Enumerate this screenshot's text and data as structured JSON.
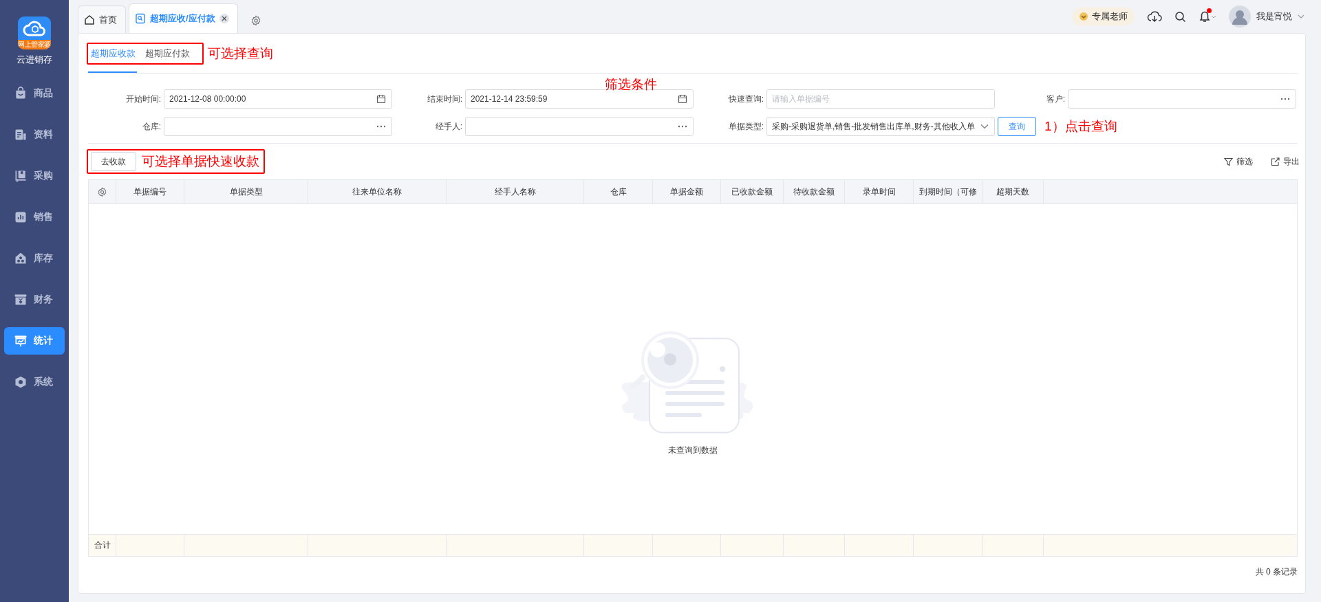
{
  "sidebar": {
    "logo_badge": "网上管家婆",
    "app_name": "云进销存",
    "items": [
      {
        "label": "商品",
        "kind": "goods",
        "selected": false
      },
      {
        "label": "资料",
        "kind": "records",
        "selected": false
      },
      {
        "label": "采购",
        "kind": "purchase",
        "selected": false
      },
      {
        "label": "销售",
        "kind": "sales",
        "selected": false
      },
      {
        "label": "库存",
        "kind": "stock",
        "selected": false
      },
      {
        "label": "财务",
        "kind": "finance",
        "selected": false
      },
      {
        "label": "统计",
        "kind": "stats",
        "selected": true
      },
      {
        "label": "系统",
        "kind": "system",
        "selected": false
      }
    ]
  },
  "top_tabs": [
    {
      "label": "首页",
      "kind": "home",
      "selected": false,
      "closable": false
    },
    {
      "label": "超期应收/应付款",
      "kind": "report",
      "selected": true,
      "closable": true
    }
  ],
  "header": {
    "teacher": "专属老师",
    "user_name": "我是宵悦",
    "has_notification": true
  },
  "subtabs": [
    {
      "label": "超期应收款",
      "selected": true
    },
    {
      "label": "超期应付款",
      "selected": false
    }
  ],
  "filters": [
    {
      "label": "开始时间:",
      "kind": "date",
      "value": "2021-12-08 00:00:00"
    },
    {
      "label": "结束时间:",
      "kind": "date",
      "value": "2021-12-14 23:59:59"
    },
    {
      "label": "快速查询:",
      "kind": "text",
      "placeholder": "请输入单据编号"
    },
    {
      "label": "客户:",
      "kind": "picker"
    },
    {
      "label": "仓库:",
      "kind": "picker"
    },
    {
      "label": "经手人:",
      "kind": "picker"
    },
    {
      "label": "单据类型:",
      "kind": "select",
      "value": "采购-采购退货单,销售-批发销售出库单,财务-其他收入单"
    }
  ],
  "query_button": "查询",
  "collect_button": "去收款",
  "toolbar": [
    {
      "label": "筛选",
      "kind": "filter"
    },
    {
      "label": "导出",
      "kind": "export"
    }
  ],
  "table": {
    "columns": [
      "单据编号",
      "单据类型",
      "往来单位名称",
      "经手人名称",
      "仓库",
      "单据金额",
      "已收款金额",
      "待收款金额",
      "录单时间",
      "到期时间（可修",
      "超期天数"
    ],
    "footer_label": "合计",
    "empty_text": "未查询到数据"
  },
  "record_count": "共 0 条记录",
  "annotations": {
    "subtabs": {
      "text": "可选择查询",
      "boxed": true
    },
    "filters": {
      "text": "筛选条件",
      "boxed": false
    },
    "query": {
      "text": "1）点击查询",
      "boxed": false
    },
    "collect": {
      "text": "可选择单据快速收款",
      "boxed": true
    }
  }
}
